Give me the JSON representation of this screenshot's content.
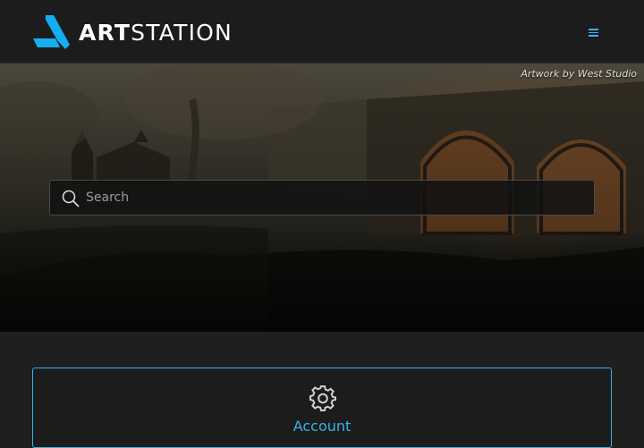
{
  "header": {
    "logo_text_bold": "ART",
    "logo_text_light": "STATION",
    "menu_icon": "hamburger-menu-icon"
  },
  "hero": {
    "credit": "Artwork by West Studio"
  },
  "search": {
    "placeholder": "Search",
    "value": "",
    "icon": "search-icon"
  },
  "cards": [
    {
      "label": "Account",
      "icon": "gear-icon"
    }
  ],
  "colors": {
    "accent": "#35b3e8",
    "background": "#1f1f1f",
    "topbar": "#1c1c1c"
  }
}
